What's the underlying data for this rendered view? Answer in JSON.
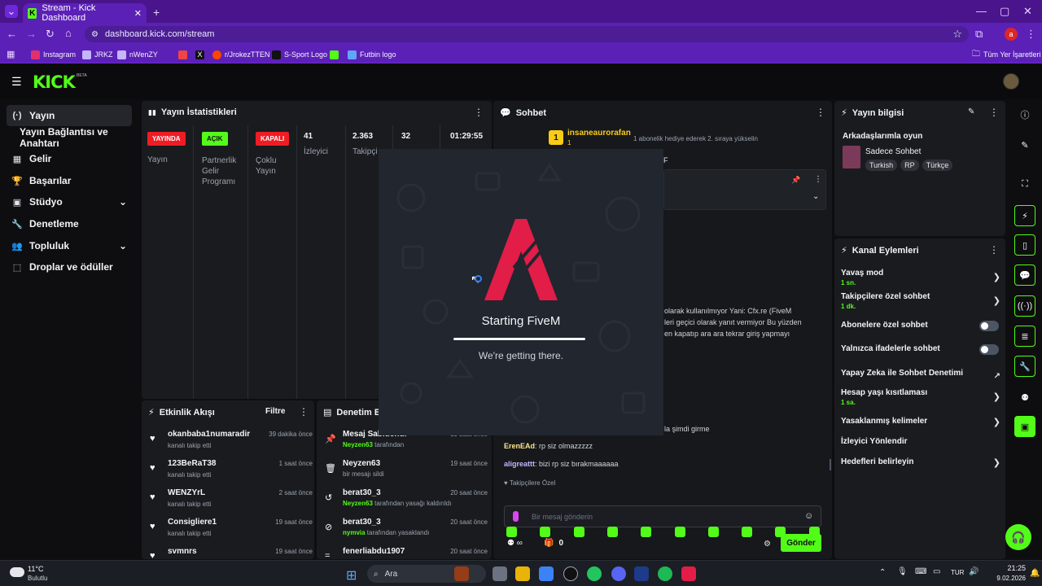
{
  "browser": {
    "tab_title": "Stream - Kick Dashboard",
    "url": "dashboard.kick.com/stream",
    "profile_initial": "a",
    "bookmarks": [
      "Instagram",
      "JRKZ",
      "nWenZY",
      "",
      "",
      "r/JrokezTTEN",
      "S-Sport Logo",
      "",
      "Futbin logo"
    ],
    "all_bookmarks": "Tüm Yer İşaretleri"
  },
  "app": {
    "logo": "KICK",
    "beta": "BETA"
  },
  "sidebar": {
    "items": [
      {
        "icon": "(·)",
        "label": "Yayın"
      },
      {
        "icon": "",
        "label": "Yayın Bağlantısı ve Anahtarı"
      },
      {
        "icon": "▦",
        "label": "Gelir"
      },
      {
        "icon": "🏆",
        "label": "Başarılar"
      },
      {
        "icon": "▣",
        "label": "Stüdyo"
      },
      {
        "icon": "🔧",
        "label": "Denetleme"
      },
      {
        "icon": "👥",
        "label": "Topluluk"
      },
      {
        "icon": "⬚",
        "label": "Droplar ve ödüller"
      }
    ]
  },
  "stats": {
    "title": "Yayın İstatistikleri",
    "items": [
      {
        "badge": "YAYINDA",
        "label": "Yayın",
        "color": "#ef1c24"
      },
      {
        "badge": "AÇIK",
        "label": "Partnerlik Gelir Programı",
        "color": "#53fc18"
      },
      {
        "badge": "KAPALI",
        "label": "Çoklu Yayın",
        "color": "#ef1c24"
      },
      {
        "value": "41",
        "label": "İzleyici"
      },
      {
        "value": "2.363",
        "label": "Takipçi"
      },
      {
        "value": "32",
        "label": ""
      },
      {
        "value": "01:29:55",
        "label": ""
      }
    ]
  },
  "activity": {
    "title": "Etkinlik Akışı",
    "filter": "Filtre",
    "events": [
      {
        "name": "okanbaba1numaradir",
        "sub": "kanalı takip etti",
        "time": "39 dakika önce"
      },
      {
        "name": "123BeRaT38",
        "sub": "kanalı takip etti",
        "time": "1 saat önce"
      },
      {
        "name": "WENZYrL",
        "sub": "kanalı takip etti",
        "time": "2 saat önce"
      },
      {
        "name": "Consigliere1",
        "sub": "kanalı takip etti",
        "time": "19 saat önce"
      },
      {
        "name": "svmnrs",
        "sub": "",
        "time": "19 saat önce"
      }
    ]
  },
  "modlog": {
    "title": "Denetim Eyl",
    "entries": [
      {
        "icon": "📌",
        "title": "Mesaj Sabitlendi",
        "user": "Neyzen63",
        "rest": " tarafından",
        "time": "19 saat önce"
      },
      {
        "icon": "🗑",
        "title": "Neyzen63",
        "user": "",
        "rest": "bir mesajı sildi",
        "time": "19 saat önce"
      },
      {
        "icon": "↺",
        "title": "berat30_3",
        "user": "Neyzen63",
        "rest": " tarafından yasağı kaldırıldı",
        "time": "20 saat önce"
      },
      {
        "icon": "⊘",
        "title": "berat30_3",
        "user": "nymvia",
        "rest": " tarafından yasaklandı",
        "time": "20 saat önce"
      },
      {
        "icon": "=",
        "title": "fenerliabdu1907",
        "user": "",
        "rest": "",
        "time": "20 saat önce"
      }
    ]
  },
  "chat": {
    "title": "Sohbet",
    "gift_user": "insaneaurorafan",
    "gift_count": "1",
    "gift_msg": "1 abonelik hediye ederek 2. sıraya yükselin",
    "pinned_letter": "F",
    "visible_lines": [
      "olarak kullanılmıyor Yani: Cfx.re (FiveM",
      "leri geçici olarak yanıt vermiyor Bu yüzden",
      "en kapatıp ara ara tekrar giriş yapmayı"
    ],
    "partial_line": "la şimdi girme",
    "messages": [
      {
        "user": "ErenEAd",
        "color": "#fde68a",
        "text": ": rp siz olmazzzzz"
      },
      {
        "user": "aligreattt",
        "color": "#c4b5fd",
        "text": ": bizi rp siz bırakmaaaaaa"
      }
    ],
    "followers_only": "Takipçilere Özel",
    "input_placeholder": "Bir mesaj gönderin",
    "points": "0",
    "send": "Gönder"
  },
  "loader": {
    "title": "Starting FiveM",
    "subtitle": "We're getting there."
  },
  "stream_info": {
    "title": "Yayın bilgisi",
    "stream_title": "Arkadaşlarımla oyun",
    "category": "Sadece Sohbet",
    "tags": [
      "Turkish",
      "RP",
      "Türkçe"
    ]
  },
  "channel_actions": {
    "title": "Kanal Eylemleri",
    "items": [
      {
        "label": "Yavaş mod",
        "sub": "1 sn.",
        "control": "chevron"
      },
      {
        "label": "Takipçilere özel sohbet",
        "sub": "1 dk.",
        "control": "chevron"
      },
      {
        "label": "Abonelere özel sohbet",
        "sub": "",
        "control": "toggle"
      },
      {
        "label": "Yalnızca ifadelerle sohbet",
        "sub": "",
        "control": "toggle"
      },
      {
        "label": "Yapay Zeka ile Sohbet Denetimi",
        "sub": "",
        "control": "external"
      },
      {
        "label": "Hesap yaşı kısıtlaması",
        "sub": "1 sa.",
        "control": "chevron"
      },
      {
        "label": "Yasaklanmış kelimeler",
        "sub": "",
        "control": "chevron"
      },
      {
        "label": "İzleyici Yönlendir",
        "sub": "",
        "control": "none"
      },
      {
        "label": "Hedefleri belirleyin",
        "sub": "",
        "control": "chevron"
      }
    ]
  },
  "taskbar": {
    "weather_temp": "11°C",
    "weather_desc": "Bulutlu",
    "search": "Ara",
    "lang": "TUR",
    "time": "21:25",
    "date": "9.02.2026"
  }
}
